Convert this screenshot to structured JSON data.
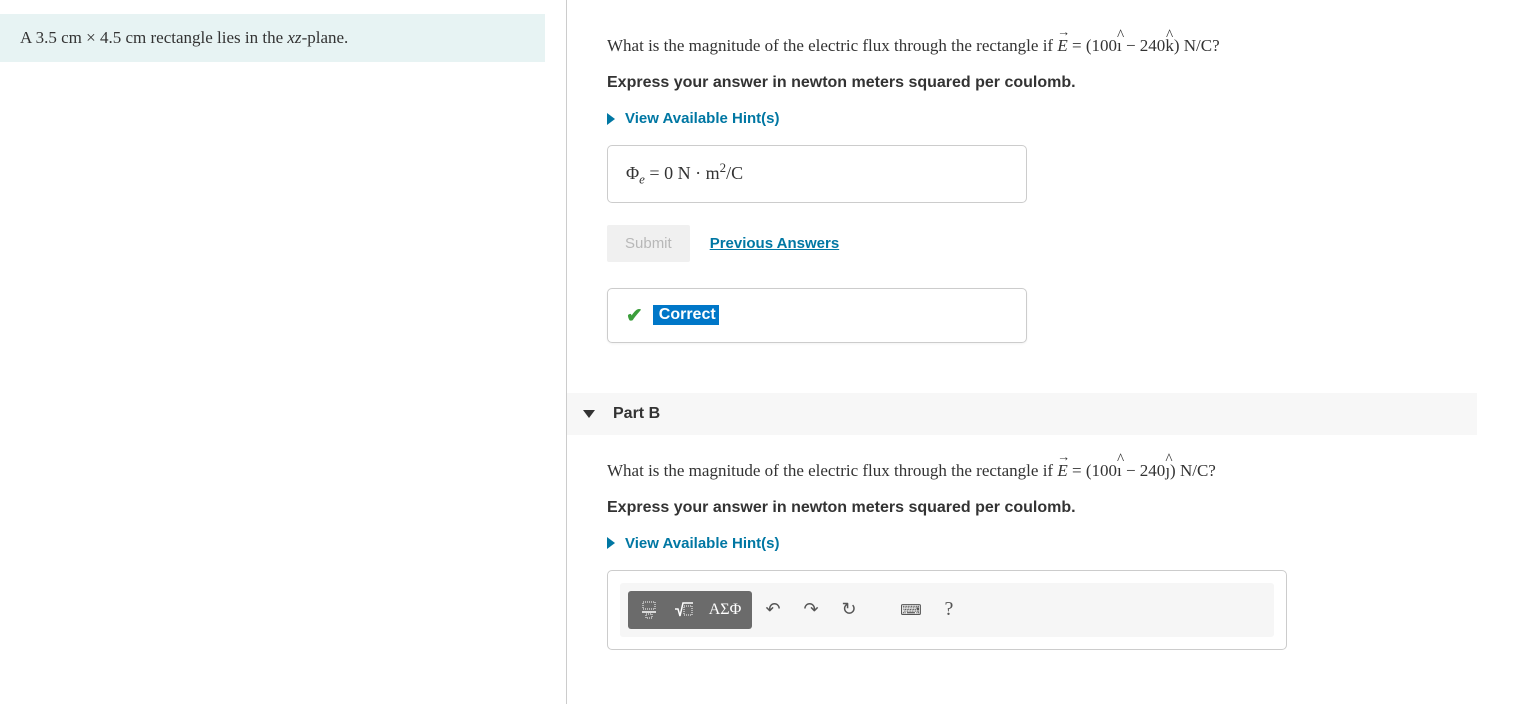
{
  "context": {
    "prefix": "A ",
    "dim1": "3.5 cm",
    "times": " × ",
    "dim2": "4.5 cm",
    "suffix_a": " rectangle lies in the ",
    "plane": "xz",
    "suffix_b": "-plane."
  },
  "partA": {
    "q_prefix": "What is the magnitude of the electric flux through the rectangle if ",
    "E_sym": "E",
    "eq": " = (100",
    "i_hat": "ı",
    "mid": " − 240",
    "k_hat": "k",
    "q_suffix": ") N/C?",
    "instruction": "Express your answer in newton meters squared per coulomb.",
    "hints_label": "View Available Hint(s)",
    "ans_sym": "Φ",
    "ans_sub": "e",
    "ans_eq": " = ",
    "ans_val": "0",
    "ans_unit_a": "  N · m",
    "ans_unit_sup": "2",
    "ans_unit_b": "/C",
    "submit": "Submit",
    "prev": "Previous Answers",
    "correct": "Correct"
  },
  "partB": {
    "header": "Part B",
    "q_prefix": "What is the magnitude of the electric flux through the rectangle if ",
    "E_sym": "E",
    "eq": " = (100",
    "i_hat": "ı",
    "mid": " − 240",
    "j_hat": "ȷ",
    "q_suffix": ") N/C?",
    "instruction": "Express your answer in newton meters squared per coulomb.",
    "hints_label": "View Available Hint(s)",
    "toolbar": {
      "fraction": "▭",
      "root": "√",
      "greek": "ΑΣΦ",
      "undo": "↶",
      "redo": "↷",
      "reset": "↻",
      "keyboard": "⌨",
      "help": "?"
    }
  }
}
